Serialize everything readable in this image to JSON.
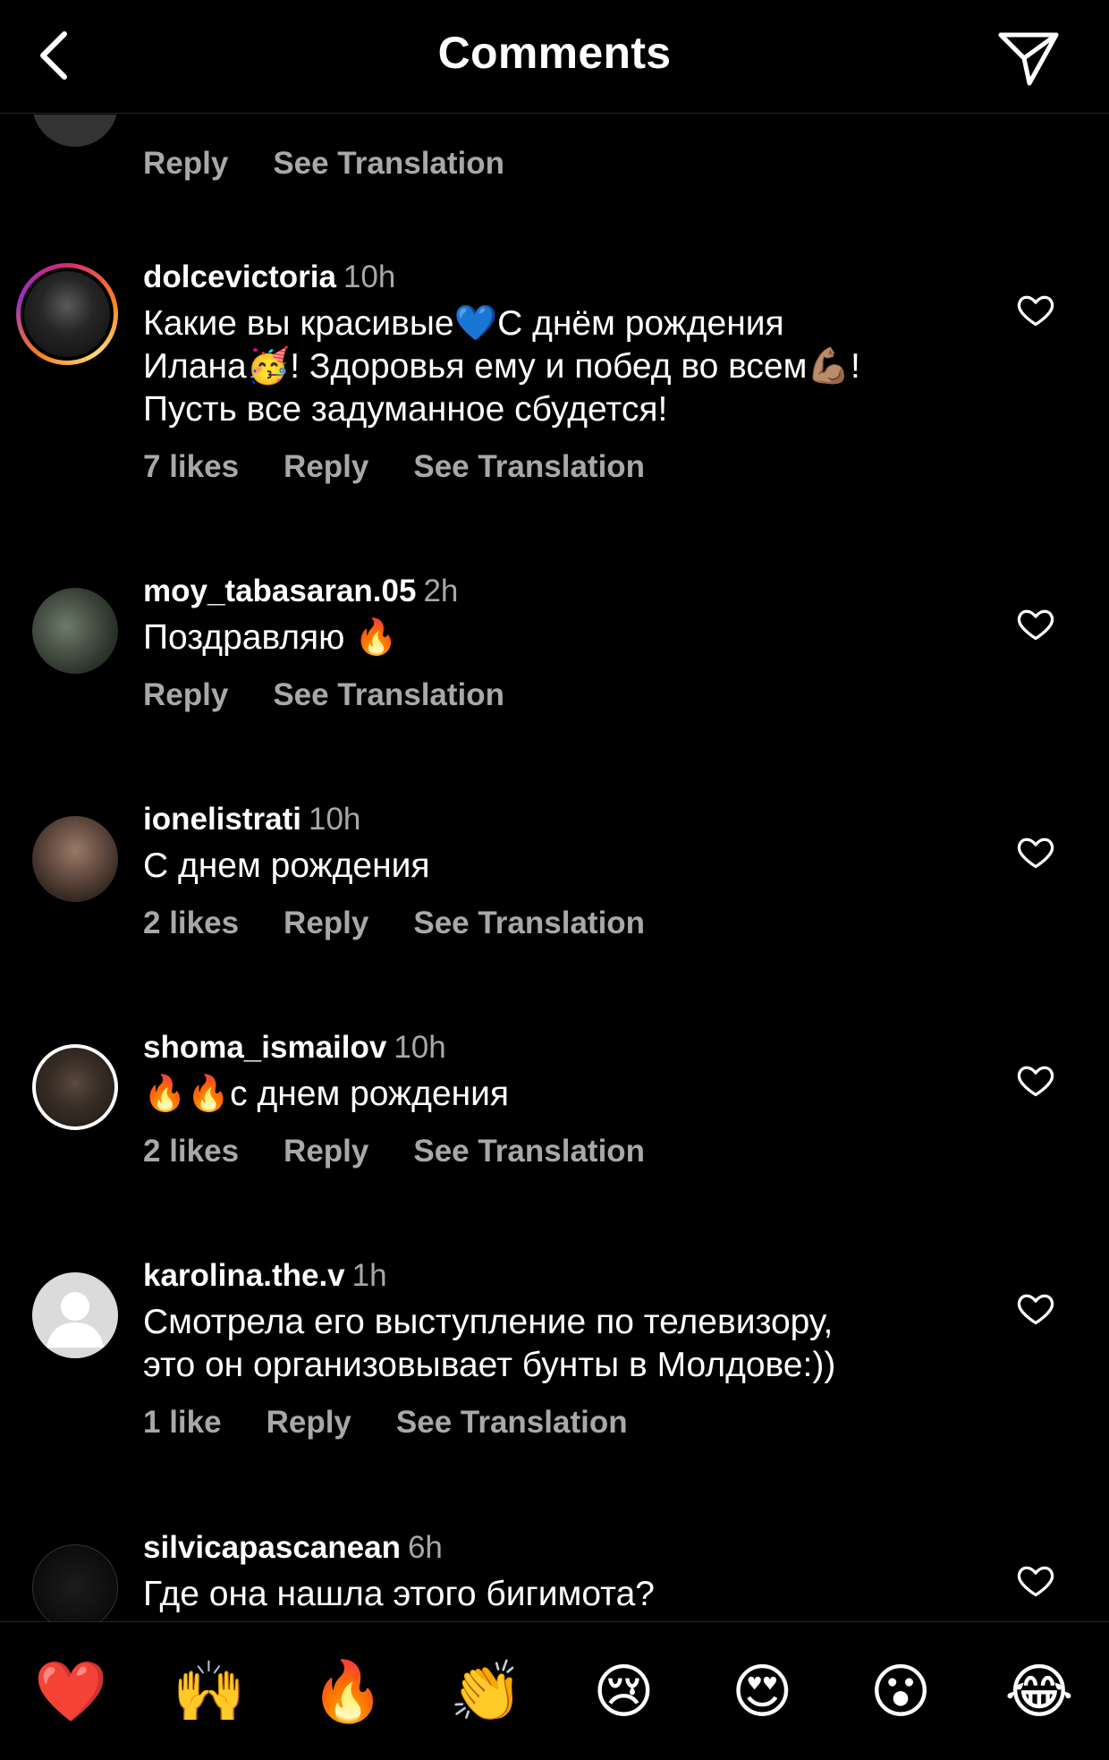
{
  "header": {
    "title": "Comments"
  },
  "partial_top": {
    "reply": "Reply",
    "see_translation": "See Translation"
  },
  "comments": [
    {
      "username": "dolcevictoria",
      "time": "10h",
      "text_lines": [
        "Какие вы красивые💙С днём рождения",
        "Илана🥳! Здоровья ему и побед во всем💪🏽!",
        "Пусть все задуманное сбудется!"
      ],
      "likes": "7 likes",
      "reply": "Reply",
      "see_translation": "See Translation"
    },
    {
      "username": "moy_tabasaran.05",
      "time": "2h",
      "text_lines": [
        "Поздравляю 🔥"
      ],
      "likes": "",
      "reply": "Reply",
      "see_translation": "See Translation"
    },
    {
      "username": "ionelistrati",
      "time": "10h",
      "text_lines": [
        "С днем рождения"
      ],
      "likes": "2 likes",
      "reply": "Reply",
      "see_translation": "See Translation"
    },
    {
      "username": "shoma_ismailov",
      "time": "10h",
      "text_lines": [
        "🔥🔥с днем рождения"
      ],
      "likes": "2 likes",
      "reply": "Reply",
      "see_translation": "See Translation"
    },
    {
      "username": "karolina.the.v",
      "time": "1h",
      "text_lines": [
        "Смотрела его выступление по телевизору,",
        "это он организовывает бунты в Молдове:))"
      ],
      "likes": "1 like",
      "reply": "Reply",
      "see_translation": "See Translation"
    },
    {
      "username": "silvicapascanean",
      "time": "6h",
      "text_lines": [
        "Где она нашла этого бигимота?"
      ],
      "likes": "",
      "reply": "",
      "see_translation": ""
    }
  ],
  "reactions": [
    "❤️",
    "🙌",
    "🔥",
    "👏",
    "😢",
    "😍",
    "😮",
    "😂"
  ],
  "colors": {
    "background": "#000000",
    "secondary_text": "#a8a8a8",
    "divider": "#262626"
  }
}
